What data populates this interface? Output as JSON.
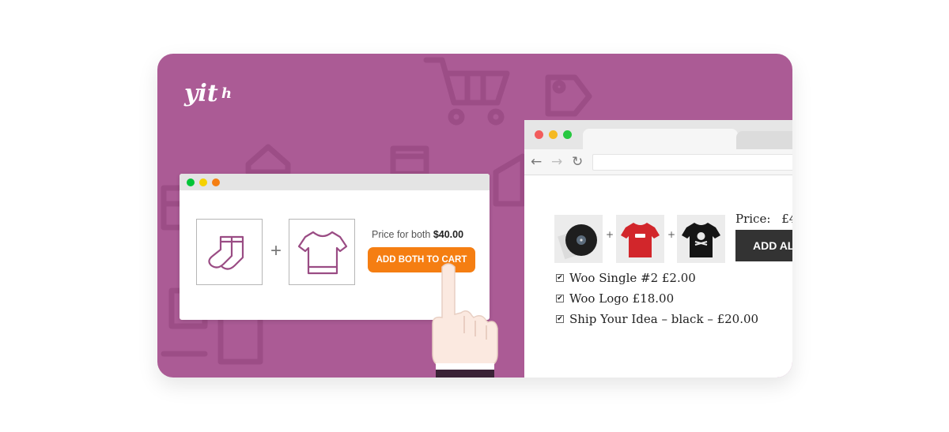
{
  "brand": {
    "logo_text": "yith"
  },
  "colors": {
    "background": "#ab5b95",
    "orange_button": "#f57e12",
    "dark_button": "#333333"
  },
  "mini_window": {
    "window_dots": [
      "#00c436",
      "#f5d100",
      "#f57e12"
    ],
    "products": [
      {
        "icon": "socks-icon"
      },
      {
        "icon": "tshirt-icon"
      }
    ],
    "plus": "+",
    "price_prefix": "Price for both",
    "price_value": "$40.00",
    "button_label": "ADD BOTH TO CART"
  },
  "browser": {
    "traffic_lights": [
      "#f25c5c",
      "#f5b921",
      "#27c840"
    ],
    "nav": {
      "back": "←",
      "forward": "→",
      "reload": "↻"
    },
    "thumbnails": [
      {
        "icon": "vinyl-record-icon"
      },
      {
        "icon": "red-tshirt-icon"
      },
      {
        "icon": "black-tshirt-icon"
      }
    ],
    "plus": "+",
    "price_label": "Price:",
    "price_value": "£4",
    "add_all_label": "ADD AL",
    "items": [
      {
        "checked": true,
        "label": "Woo Single #2 £2.00"
      },
      {
        "checked": true,
        "label": "Woo Logo £18.00"
      },
      {
        "checked": true,
        "label": "Ship Your Idea – black – £20.00"
      }
    ]
  }
}
